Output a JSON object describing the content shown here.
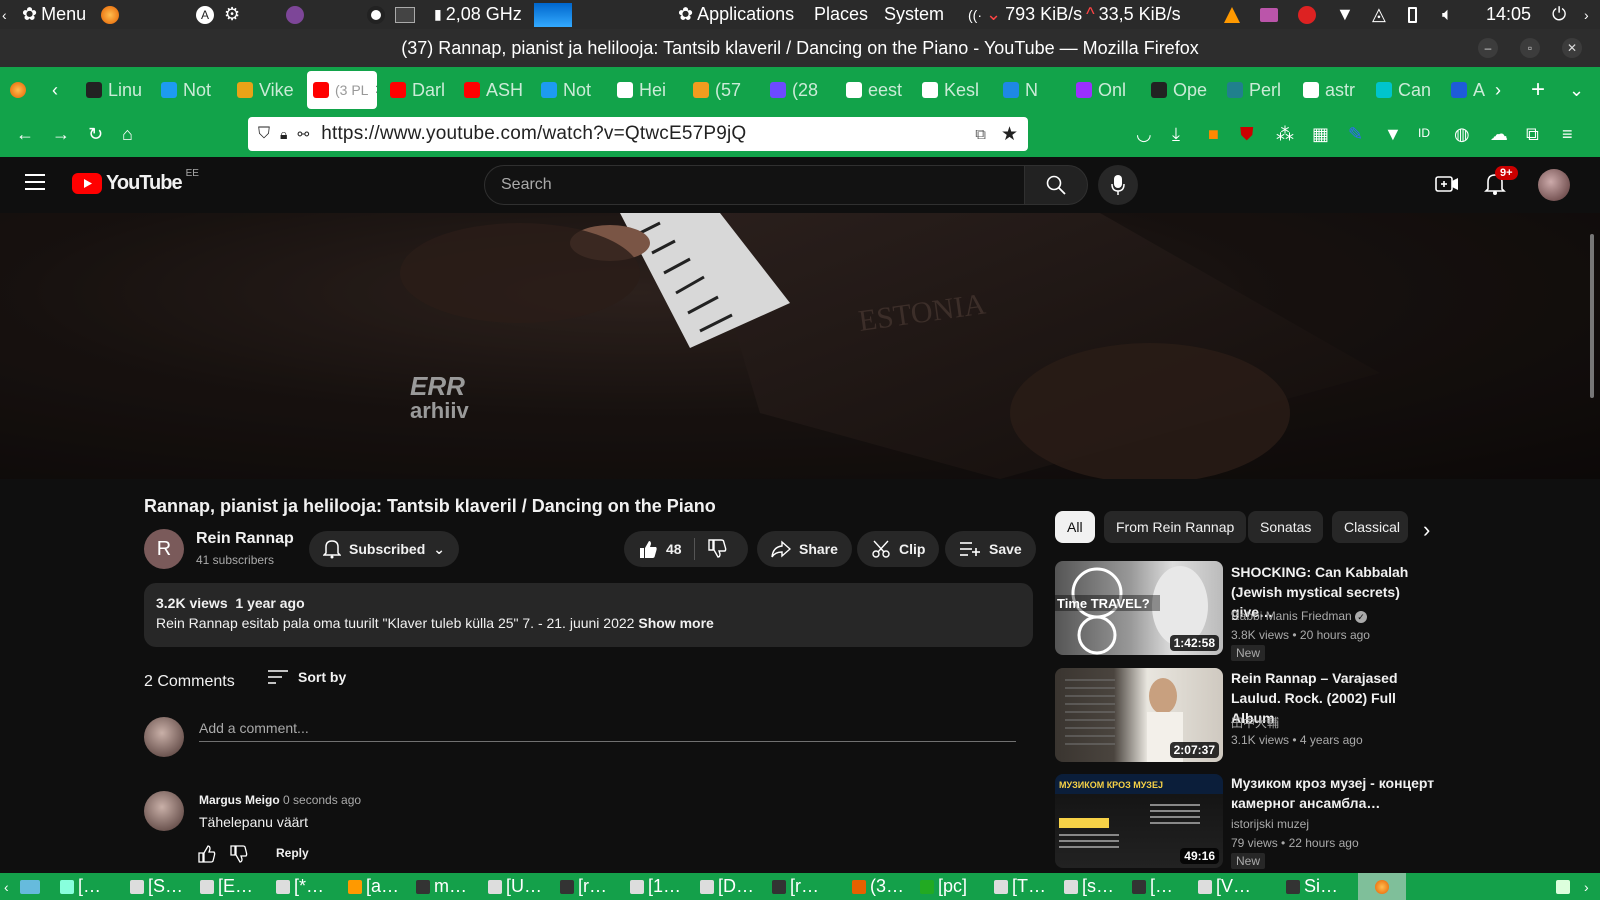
{
  "system_panel": {
    "menu_label": "Menu",
    "cpu_freq": "2,08 GHz",
    "apps": [
      "Applications",
      "Places",
      "System"
    ],
    "down_speed": "793 KiB/s",
    "up_speed": "33,5 KiB/s",
    "clock": "14:05"
  },
  "window": {
    "title": "(37) Rannap, pianist ja helilooja: Tantsib klaveril / Dancing on the Piano - YouTube — Mozilla Firefox"
  },
  "tabs": [
    {
      "label": "Linu",
      "icon": "linux-icon",
      "color": "#222"
    },
    {
      "label": "Not",
      "icon": "twitter-icon",
      "color": "#1d9bf0"
    },
    {
      "label": "Vike",
      "icon": "vike-icon",
      "color": "#e8a317"
    },
    {
      "label": "(3 PL",
      "icon": "youtube-icon",
      "color": "#ff0000",
      "active": true
    },
    {
      "label": "Darl",
      "icon": "youtube-icon",
      "color": "#ff0000"
    },
    {
      "label": "ASH",
      "icon": "youtube-icon",
      "color": "#ff0000"
    },
    {
      "label": "Not",
      "icon": "twitter-icon",
      "color": "#1d9bf0"
    },
    {
      "label": "Hei",
      "icon": "wikipedia-icon",
      "color": "#fff"
    },
    {
      "label": "(57",
      "icon": "fox-icon",
      "color": "#f29c1f"
    },
    {
      "label": "(28",
      "icon": "proton-icon",
      "color": "#6d4aff"
    },
    {
      "label": "eest",
      "icon": "google-icon",
      "color": "#fff"
    },
    {
      "label": "Kesl",
      "icon": "sheet-icon",
      "color": "#fff"
    },
    {
      "label": "N",
      "icon": "r-icon",
      "color": "#1e88e5"
    },
    {
      "label": "Onl",
      "icon": "purple-icon",
      "color": "#9b30ff"
    },
    {
      "label": "Ope",
      "icon": "openai-icon",
      "color": "#222"
    },
    {
      "label": "Perl",
      "icon": "perplexity-icon",
      "color": "#20808d"
    },
    {
      "label": "astr",
      "icon": "google-icon",
      "color": "#fff"
    },
    {
      "label": "Can",
      "icon": "canva-icon",
      "color": "#00c4cc"
    },
    {
      "label": "A",
      "icon": "doc-icon",
      "color": "#1e5bd8"
    }
  ],
  "nav": {
    "url": "https://www.youtube.com/watch?v=QtwcE57P9jQ"
  },
  "yt": {
    "logo_text": "YouTube",
    "region": "EE",
    "search_placeholder": "Search",
    "notif_count": "9+",
    "watermark_line1": "ERR",
    "watermark_line2": "arhiiv",
    "piano_brand": "ESTONIA",
    "video_title": "Rannap, pianist ja helilooja: Tantsib klaveril / Dancing on the Piano",
    "channel_initial": "R",
    "channel_name": "Rein Rannap",
    "subscribers": "41 subscribers",
    "subscribed_label": "Subscribed",
    "likes": "48",
    "share_label": "Share",
    "clip_label": "Clip",
    "save_label": "Save",
    "views": "3.2K views",
    "age": "1 year ago",
    "description": "Rein Rannap esitab pala oma tuurilt \"Klaver tuleb külla 25\" 7. - 21. juuni 2022",
    "show_more": "Show more",
    "comments_count": "2 Comments",
    "sort_by": "Sort by",
    "add_comment": "Add a comment...",
    "comment": {
      "author": "Margus Meigo",
      "time": "0 seconds ago",
      "text": "Tähelepanu väärt",
      "reply": "Reply"
    },
    "chips": [
      "All",
      "From Rein Rannap",
      "Sonatas",
      "Classical"
    ],
    "related": [
      {
        "title_line1": "SHOCKING: Can Kabbalah",
        "title_line2": "(Jewish mystical secrets) give…",
        "channel": "Rabbi Manis Friedman",
        "views": "3.8K views",
        "age": "20 hours ago",
        "duration": "1:42:58",
        "badge": "New",
        "thumb_text": "Time TRAVEL?"
      },
      {
        "title_line1": "Rein Rannap – Varajased",
        "title_line2": "Laulud. Rock. (2002) Full Album",
        "channel": "田中大輔",
        "views": "3.1K views",
        "age": "4 years ago",
        "duration": "2:07:37",
        "badge": ""
      },
      {
        "title_line1": "Музиком кроз музеј - концерт",
        "title_line2": "камерног ансамбла…",
        "channel": "istorijski muzej",
        "views": "79 views",
        "age": "22 hours ago",
        "duration": "49:16",
        "badge": "New",
        "thumb_text": "МУЗИКОМ КРОЗ МУЗЕЈ"
      }
    ]
  },
  "taskbar": [
    {
      "label": "[…",
      "color": "#8fd"
    },
    {
      "label": "[S…",
      "color": "#ddd"
    },
    {
      "label": "[E…",
      "color": "#ddd"
    },
    {
      "label": "[*…",
      "color": "#ddd"
    },
    {
      "label": "[a…",
      "color": "#f90"
    },
    {
      "label": "m…",
      "color": "#333"
    },
    {
      "label": "[U…",
      "color": "#ddd"
    },
    {
      "label": "[r…",
      "color": "#333"
    },
    {
      "label": "[1…",
      "color": "#ddd"
    },
    {
      "label": "[D…",
      "color": "#ddd"
    },
    {
      "label": "[r…",
      "color": "#333"
    },
    {
      "label": "(3…",
      "color": "#e66000"
    },
    {
      "label": "[pc]",
      "color": "#2a2"
    },
    {
      "label": "[T…",
      "color": "#ddd"
    },
    {
      "label": "[s…",
      "color": "#ddd"
    },
    {
      "label": "[…",
      "color": "#333"
    },
    {
      "label": "[V…",
      "color": "#ddd"
    },
    {
      "label": "Si…",
      "color": "#333"
    }
  ]
}
